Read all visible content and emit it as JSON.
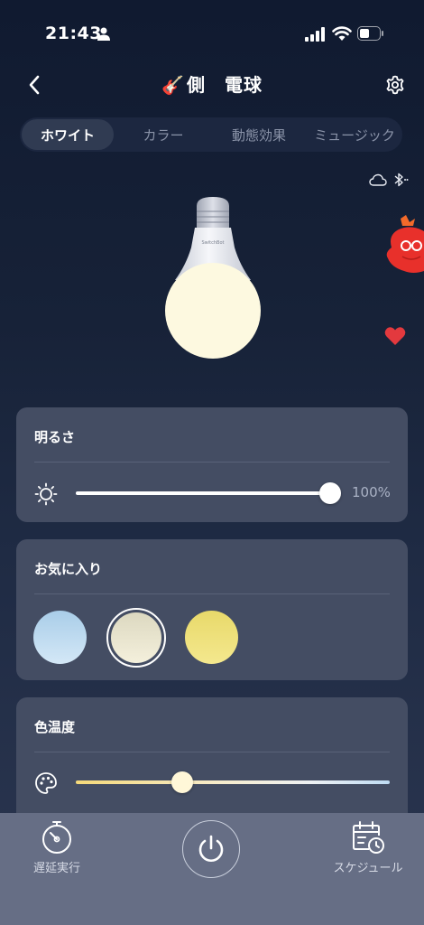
{
  "status_bar": {
    "time": "21:43",
    "icons": [
      "person-icon",
      "cellular-signal-icon",
      "wifi-icon",
      "battery-icon"
    ]
  },
  "header": {
    "emoji": "🎸",
    "title": "側　電球",
    "back_icon": "chevron-left-icon",
    "settings_icon": "gear-icon"
  },
  "tabs": [
    {
      "label": "ホワイト",
      "active": true
    },
    {
      "label": "カラー",
      "active": false
    },
    {
      "label": "動態効果",
      "active": false
    },
    {
      "label": "ミュージック",
      "active": false
    }
  ],
  "connectivity": {
    "icons": [
      "cloud-icon",
      "bluetooth-icon"
    ]
  },
  "bulb": {
    "brand": "SwitchBot",
    "light_color": "#fdf9e0"
  },
  "brightness": {
    "title": "明るさ",
    "value_text": "100%",
    "level_percent": 100
  },
  "favorites": {
    "title": "お気に入り",
    "swatches": [
      {
        "color": "#c4def2",
        "selected": false
      },
      {
        "color": "#ebe7d0",
        "selected": true
      },
      {
        "color": "#efe17a",
        "selected": false
      }
    ]
  },
  "color_temperature": {
    "title": "色温度",
    "level_fraction": 0.34,
    "gradient": [
      "#f5d97a",
      "#f7eccb",
      "#eef1f4",
      "#bfdcf3"
    ]
  },
  "bottom_bar": {
    "delay_label": "遅延実行",
    "schedule_label": "スケジュール",
    "power_icon": "power-icon"
  },
  "colors": {
    "background_top": "#101a30",
    "card": "#444d63",
    "bottom_bar": "#666e85",
    "heart": "#e3393e"
  }
}
